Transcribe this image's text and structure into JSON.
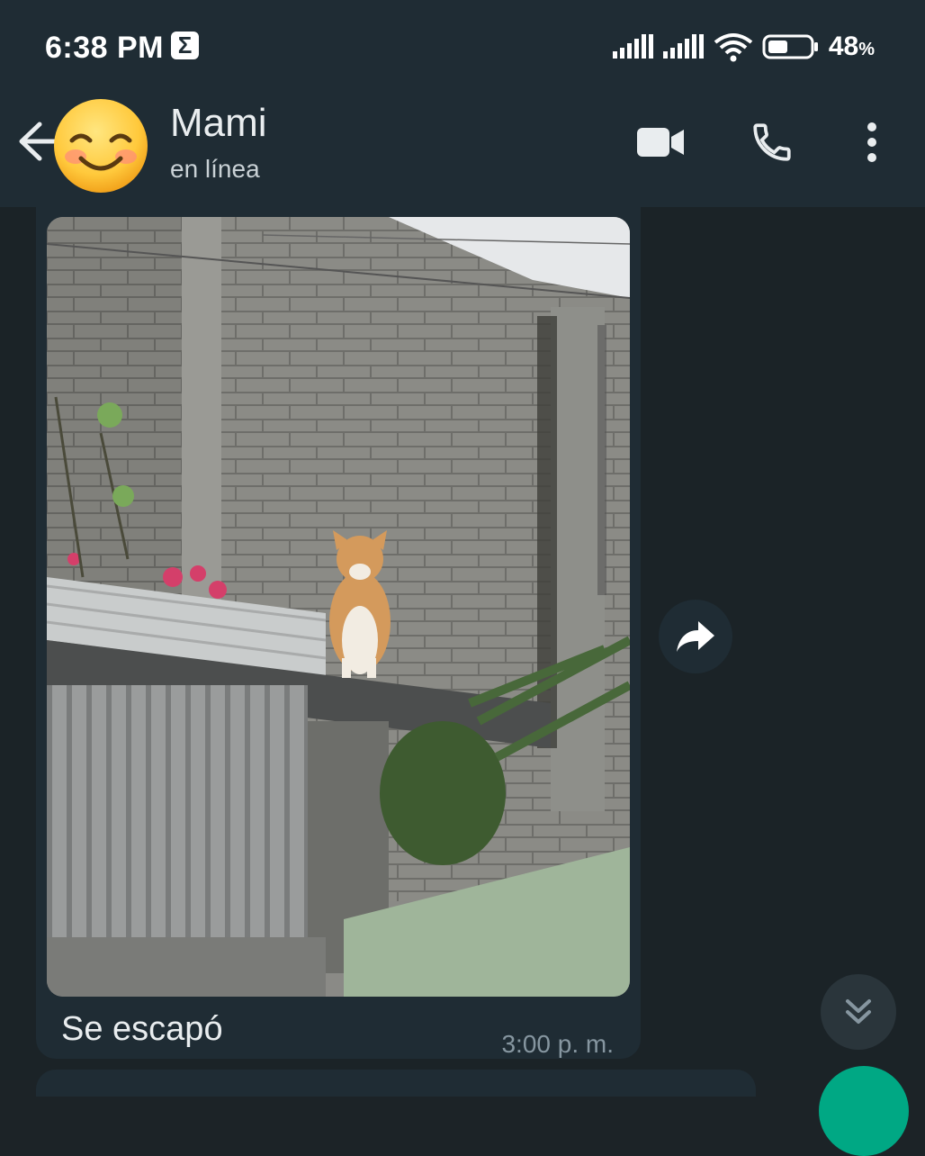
{
  "status_bar": {
    "time": "6:38 PM",
    "notification_icon": "sigma-icon",
    "notification_glyph": "Σ",
    "battery_percent": "48",
    "battery_unit": "%",
    "battery_level": 0.48,
    "icons": [
      "signal-icon",
      "signal-icon",
      "wifi-icon",
      "battery-icon"
    ]
  },
  "header": {
    "contact_name": "Mami",
    "contact_status": "en línea",
    "avatar_emoji": "😊",
    "icons": [
      "back-arrow-icon",
      "video-call-icon",
      "phone-icon",
      "more-vert-icon"
    ]
  },
  "chat": {
    "message": {
      "photo_subject": "cat-photo",
      "caption": "Se escapó",
      "time": "3:00 p. m."
    },
    "icons": [
      "forward-icon",
      "scroll-down-icon"
    ]
  },
  "colors": {
    "header_bg": "#1f2c34",
    "chat_bg": "#1b2327",
    "bubble_bg": "#1f2c34",
    "accent_green": "#00a884",
    "secondary_text": "#8696a0"
  }
}
